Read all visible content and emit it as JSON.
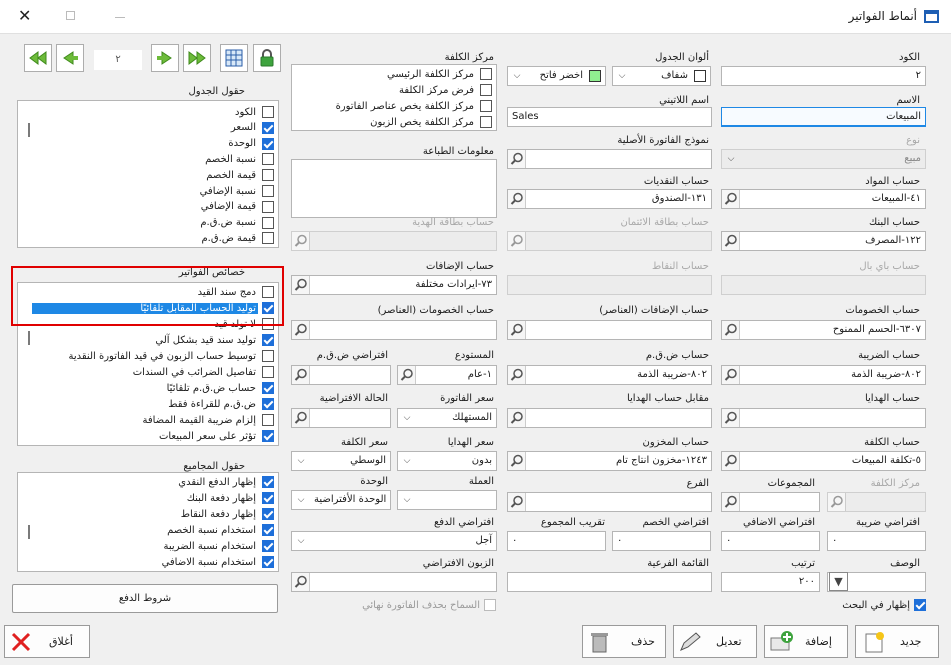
{
  "window": {
    "title": "أنماط الفواتير"
  },
  "nav": {
    "page": "٢"
  },
  "labels": {
    "code": "الكود",
    "name": "الاسم",
    "type": "نوع",
    "materials_account": "حساب المواد",
    "bank_account": "حساب البنك",
    "paypal_account": "حساب باي بال",
    "discounts_account": "حساب الخصومات",
    "tax_account": "حساب الضريبة",
    "gifts_account": "حساب الهدايا",
    "cost_account": "حساب الكلفة",
    "cost_center": "مركز الكلفة",
    "groups": "المجموعات",
    "default_tax": "افتراضي ضريبة",
    "default_additional": "افتراضي الاضافي",
    "description": "الوصف",
    "order": "ترتيب",
    "table_colors": "ألوان الجدول",
    "latin_name": "اسم اللاتيني",
    "original_invoice_model": "نموذج الفاتورة الأصلية",
    "cash_account": "حساب النقديات",
    "credit_card_account": "حساب بطاقة الائتمان",
    "points_account": "حساب النقاط",
    "additions_items_account": "حساب الإضافات (العناصر)",
    "vat_account": "حساب ض.ق.م",
    "gifts_counter_account": "مقابل حساب الهدايا",
    "inventory_account": "حساب المخزون",
    "branch": "الفرع",
    "default_discount": "افتراضي الخصم",
    "subcategory_list": "القائمة الفرعية",
    "rounding_total": "تقريب المجموع",
    "cost_center_col": "مركز الكلفة",
    "printing_info": "معلومات الطباعة",
    "gift_card_account": "حساب بطاقة الهدية",
    "additions_account": "حساب الإضافات",
    "discounts_items_account": "حساب الخصومات (العناصر)",
    "warehouse": "المستودع",
    "vat_default": "افتراضي ض.ق.م",
    "invoice_price": "سعر الفاتورة",
    "default_status": "الحالة الافتراضية",
    "gifts_price": "سعر الهدايا",
    "cost_price": "سعر الكلفة",
    "currency": "العملة",
    "unit": "الوحدة",
    "default_payment": "افتراضي الدفع",
    "default_customer": "الزبون الافتراضي",
    "table_fields": "حقول الجدول",
    "invoice_properties": "خصائص الفواتير",
    "totals_fields": "حقول المجاميع"
  },
  "values": {
    "code": "٢",
    "name": "المبيعات",
    "type": "مبيع",
    "materials_account": "٤١-المبيعات",
    "bank_account": "١٢٢-المصرف",
    "discounts_account": "٦٣٠٧-الحسم الممنوح",
    "tax_account": "٨٠٢-ضريبة الذمة",
    "cost_account": "٥-تكلفة المبيعات",
    "default_tax": "٠",
    "default_additional": "٠",
    "order": "٢٠٠",
    "color1": "شفاف",
    "color2": "اخضر فاتح",
    "latin_name": "Sales",
    "cash_account": "١٣١-الصندوق",
    "vat_account": "٨٠٢-ضريبة الذمة",
    "inventory_account": "١٢٤٣-مخزون انتاج تام",
    "default_discount": "٠",
    "rounding_total": "٠",
    "additions_account": "٧٣-ايرادات مختلفة",
    "warehouse": "١-عام",
    "invoice_price": "المستهلك",
    "gifts_price": "بدون",
    "cost_price": "الوسطي",
    "unit": "الوحدة الأفتراضية",
    "default_payment": "آجل"
  },
  "colors": {
    "swatch1": "#ffffff",
    "swatch2": "#90ee90",
    "accent": "#1e88e5",
    "highlight_box": "#e00000"
  },
  "cost_center_options": [
    {
      "label": "مركز الكلفة الرئيسي",
      "checked": false
    },
    {
      "label": "فرض مركز الكلفة",
      "checked": false
    },
    {
      "label": "مركز الكلفة يخص عناصر الفاتورة",
      "checked": false
    },
    {
      "label": "مركز الكلفة يخص الزبون",
      "checked": false
    }
  ],
  "table_fields": [
    {
      "label": "الكود",
      "checked": false
    },
    {
      "label": "السعر",
      "checked": true
    },
    {
      "label": "الوحدة",
      "checked": true
    },
    {
      "label": "نسبة الخصم",
      "checked": false
    },
    {
      "label": "قيمة الخصم",
      "checked": false
    },
    {
      "label": "نسبة الإضافي",
      "checked": false
    },
    {
      "label": "قيمة الإضافي",
      "checked": false
    },
    {
      "label": "نسبة ض.ق.م",
      "checked": false
    },
    {
      "label": "قيمة ض.ق.م",
      "checked": false
    }
  ],
  "invoice_properties": [
    {
      "label": "دمج سند القيد",
      "checked": false
    },
    {
      "label": "توليد الحساب المقابل تلقائيًا",
      "checked": true,
      "selected": true
    },
    {
      "label": "لا تولد قيد",
      "checked": false
    },
    {
      "label": "توليد سند قيد بشكل آلي",
      "checked": true
    },
    {
      "label": "توسيط حساب الزبون في قيد الفاتورة النقدية",
      "checked": false
    },
    {
      "label": "تفاصيل الضرائب في السندات",
      "checked": false
    },
    {
      "label": "حساب ض.ق.م تلقائيًا",
      "checked": true
    },
    {
      "label": "ض.ق.م للقراءة فقط",
      "checked": true
    },
    {
      "label": "إلزام ضريبة القيمة المضافة",
      "checked": false
    },
    {
      "label": "تؤثر على سعر المبيعات",
      "checked": true
    }
  ],
  "totals_fields": [
    {
      "label": "إظهار الدفع النقدي",
      "checked": true
    },
    {
      "label": "إظهار دفعة البنك",
      "checked": true
    },
    {
      "label": "إظهار دفعة النقاط",
      "checked": true
    },
    {
      "label": "استخدام نسبة الخصم",
      "checked": true
    },
    {
      "label": "استخدام نسبة الضريبة",
      "checked": true
    },
    {
      "label": "استخدام نسبة الاضافي",
      "checked": true
    }
  ],
  "checks": {
    "show_in_search": "إظهار في البحث",
    "allow_delete_final": "السماح بحذف الفاتورة نهائي"
  },
  "buttons": {
    "payment_terms": "شروط الدفع",
    "new": "جديد",
    "add": "إضافة",
    "edit": "تعديل",
    "delete": "حذف",
    "close": "أغلاق"
  }
}
